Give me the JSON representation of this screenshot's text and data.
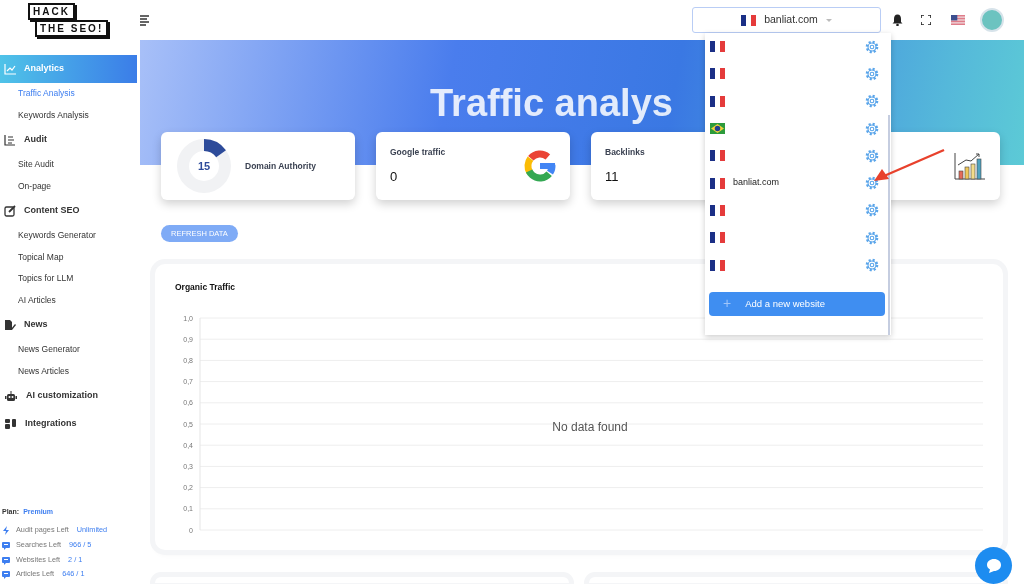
{
  "logo": {
    "lines": [
      "HACK",
      "THE SEO!"
    ]
  },
  "header": {
    "domain_select": {
      "value": "banliat.com"
    }
  },
  "sidebar": {
    "sections": [
      {
        "label": "Analytics",
        "active": true,
        "children": [
          {
            "label": "Traffic Analysis",
            "selected": true
          },
          {
            "label": "Keywords Analysis",
            "selected": false
          }
        ]
      },
      {
        "label": "Audit",
        "active": false,
        "children": [
          {
            "label": "Site Audit",
            "selected": false
          },
          {
            "label": "On-page",
            "selected": false
          }
        ]
      },
      {
        "label": "Content SEO",
        "active": false,
        "children": [
          {
            "label": "Keywords Generator",
            "selected": false
          },
          {
            "label": "Topical Map",
            "selected": false
          },
          {
            "label": "Topics for LLM",
            "selected": false
          },
          {
            "label": "AI Articles",
            "selected": false
          }
        ]
      },
      {
        "label": "News",
        "active": false,
        "children": [
          {
            "label": "News Generator",
            "selected": false
          },
          {
            "label": "News Articles",
            "selected": false
          }
        ]
      },
      {
        "label": "AI customization",
        "active": false
      },
      {
        "label": "Integrations",
        "active": false
      }
    ],
    "plan": {
      "label": "Plan:",
      "value": "Premium"
    },
    "quotas": [
      {
        "label": "Audit pages Left",
        "value": "Unlimited"
      },
      {
        "label": "Searches Left",
        "value": "966 / 5"
      },
      {
        "label": "Websites Left",
        "value": "2 / 1"
      },
      {
        "label": "Articles Left",
        "value": "646 / 1"
      }
    ]
  },
  "hero": {
    "title": "Traffic analys"
  },
  "stat_cards": [
    {
      "kind": "donut",
      "value": "15",
      "level": 0.15,
      "label": "Domain Authority"
    },
    {
      "kind": "google",
      "label": "Google traffic",
      "value": "0"
    },
    {
      "kind": "plain",
      "label": "Backlinks",
      "value": "11"
    },
    {
      "kind": "growth"
    }
  ],
  "refresh_button": {
    "label": "REFRESH DATA"
  },
  "organic_traffic": {
    "title": "Organic Traffic",
    "empty_message": "No data found",
    "y_axis_labels": [
      "1,0",
      "0,9",
      "0,8",
      "0,7",
      "0,6",
      "0,5",
      "0,4",
      "0,3",
      "0,2",
      "0,1",
      "0"
    ]
  },
  "website_dropdown": {
    "items": [
      {
        "kind": "france"
      },
      {
        "kind": "france"
      },
      {
        "kind": "france"
      },
      {
        "kind": "brazil"
      },
      {
        "kind": "france"
      },
      {
        "kind": "france",
        "name": "banliat.com"
      },
      {
        "kind": "france"
      },
      {
        "kind": "france"
      },
      {
        "kind": "france"
      }
    ],
    "add_button": {
      "icon": "+",
      "label": "Add a new website"
    }
  }
}
